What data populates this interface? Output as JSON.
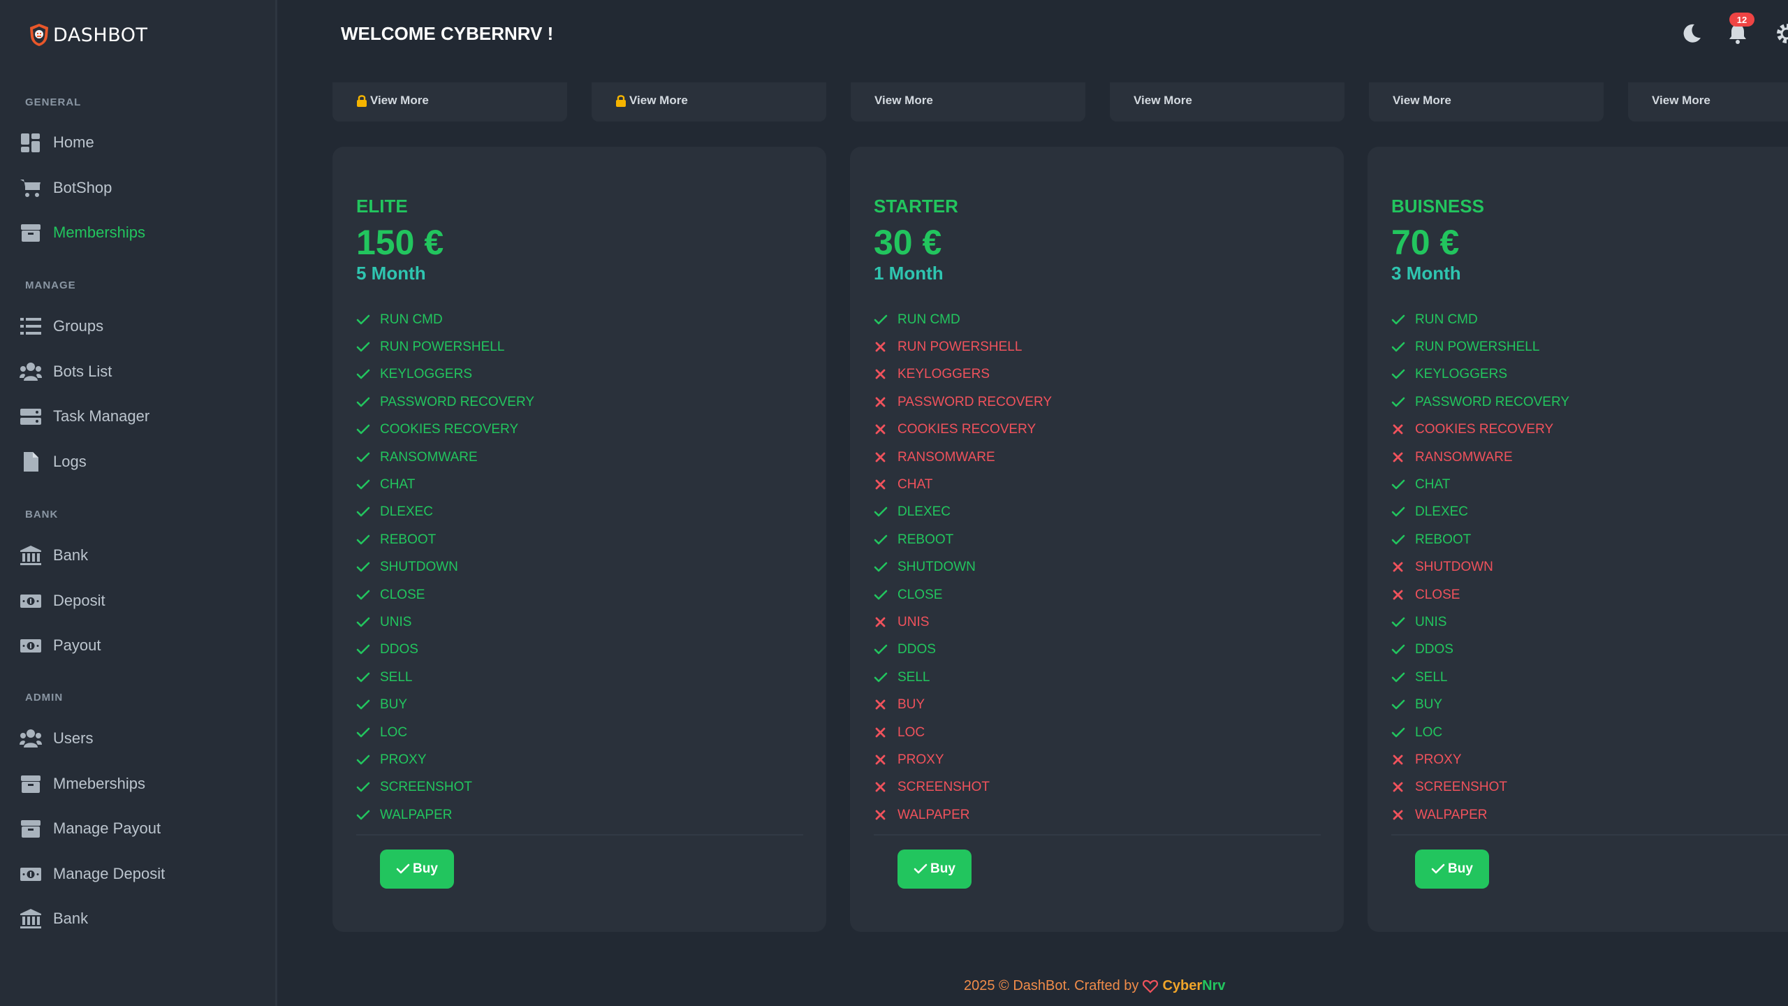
{
  "app": {
    "logo_text": "DASHBOT"
  },
  "header": {
    "welcome": "WELCOME CYBERNRV !",
    "notification_count": "12",
    "icons": [
      "moon-icon",
      "bell-icon",
      "gear-icon"
    ]
  },
  "sidebar": {
    "sections": [
      {
        "title": "GENERAL",
        "items": [
          {
            "label": "Home",
            "icon": "home-icon"
          },
          {
            "label": "BotShop",
            "icon": "cart-icon"
          },
          {
            "label": "Memberships",
            "icon": "box-icon",
            "active": true
          }
        ]
      },
      {
        "title": "MANAGE",
        "items": [
          {
            "label": "Groups",
            "icon": "list-icon"
          },
          {
            "label": "Bots List",
            "icon": "users-icon"
          },
          {
            "label": "Task Manager",
            "icon": "server-icon"
          },
          {
            "label": "Logs",
            "icon": "file-icon"
          }
        ]
      },
      {
        "title": "BANK",
        "items": [
          {
            "label": "Bank",
            "icon": "bank-icon"
          },
          {
            "label": "Deposit",
            "icon": "money-icon"
          },
          {
            "label": "Payout",
            "icon": "money-icon"
          }
        ]
      },
      {
        "title": "ADMIN",
        "items": [
          {
            "label": "Users",
            "icon": "users-icon"
          },
          {
            "label": "Mmeberships",
            "icon": "box-icon"
          },
          {
            "label": "Manage Payout",
            "icon": "box-icon"
          },
          {
            "label": "Manage Deposit",
            "icon": "money-icon"
          },
          {
            "label": "Bank",
            "icon": "bank-icon"
          }
        ]
      }
    ]
  },
  "top_cards": [
    {
      "label": "View More",
      "locked": true
    },
    {
      "label": "View More",
      "locked": true
    },
    {
      "label": "View More",
      "locked": false
    },
    {
      "label": "View More",
      "locked": false
    },
    {
      "label": "View More",
      "locked": false
    },
    {
      "label": "View More",
      "locked": false
    }
  ],
  "plans": [
    {
      "name": "ELITE",
      "price": "150 €",
      "duration": "5 Month",
      "buy_label": "Buy",
      "features": [
        [
          "RUN CMD",
          true
        ],
        [
          "RUN POWERSHELL",
          true
        ],
        [
          "KEYLOGGERS",
          true
        ],
        [
          "PASSWORD RECOVERY",
          true
        ],
        [
          "COOKIES RECOVERY",
          true
        ],
        [
          "RANSOMWARE",
          true
        ],
        [
          "CHAT",
          true
        ],
        [
          "DLEXEC",
          true
        ],
        [
          "REBOOT",
          true
        ],
        [
          "SHUTDOWN",
          true
        ],
        [
          "CLOSE",
          true
        ],
        [
          "UNIS",
          true
        ],
        [
          "DDOS",
          true
        ],
        [
          "SELL",
          true
        ],
        [
          "BUY",
          true
        ],
        [
          "LOC",
          true
        ],
        [
          "PROXY",
          true
        ],
        [
          "SCREENSHOT",
          true
        ],
        [
          "WALPAPER",
          true
        ]
      ]
    },
    {
      "name": "STARTER",
      "price": "30 €",
      "duration": "1 Month",
      "buy_label": "Buy",
      "features": [
        [
          "RUN CMD",
          true
        ],
        [
          "RUN POWERSHELL",
          false
        ],
        [
          "KEYLOGGERS",
          false
        ],
        [
          "PASSWORD RECOVERY",
          false
        ],
        [
          "COOKIES RECOVERY",
          false
        ],
        [
          "RANSOMWARE",
          false
        ],
        [
          "CHAT",
          false
        ],
        [
          "DLEXEC",
          true
        ],
        [
          "REBOOT",
          true
        ],
        [
          "SHUTDOWN",
          true
        ],
        [
          "CLOSE",
          true
        ],
        [
          "UNIS",
          false
        ],
        [
          "DDOS",
          true
        ],
        [
          "SELL",
          true
        ],
        [
          "BUY",
          false
        ],
        [
          "LOC",
          false
        ],
        [
          "PROXY",
          false
        ],
        [
          "SCREENSHOT",
          false
        ],
        [
          "WALPAPER",
          false
        ]
      ]
    },
    {
      "name": "BUISNESS",
      "price": "70 €",
      "duration": "3 Month",
      "buy_label": "Buy",
      "features": [
        [
          "RUN CMD",
          true
        ],
        [
          "RUN POWERSHELL",
          true
        ],
        [
          "KEYLOGGERS",
          true
        ],
        [
          "PASSWORD RECOVERY",
          true
        ],
        [
          "COOKIES RECOVERY",
          false
        ],
        [
          "RANSOMWARE",
          false
        ],
        [
          "CHAT",
          true
        ],
        [
          "DLEXEC",
          true
        ],
        [
          "REBOOT",
          true
        ],
        [
          "SHUTDOWN",
          false
        ],
        [
          "CLOSE",
          false
        ],
        [
          "UNIS",
          true
        ],
        [
          "DDOS",
          true
        ],
        [
          "SELL",
          true
        ],
        [
          "BUY",
          true
        ],
        [
          "LOC",
          true
        ],
        [
          "PROXY",
          false
        ],
        [
          "SCREENSHOT",
          false
        ],
        [
          "WALPAPER",
          false
        ]
      ]
    }
  ],
  "footer": {
    "text": "2025 © DashBot. Crafted by",
    "brand_a": "Cyber",
    "brand_b": "Nrv"
  },
  "colors": {
    "accent": "#22c55e",
    "danger": "#f0525c",
    "duration": "#2fc5b0",
    "bg": "#222933",
    "card": "#2a313b"
  }
}
